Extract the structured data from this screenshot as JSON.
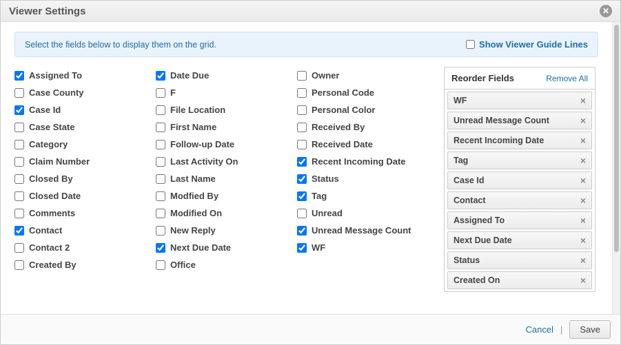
{
  "header": {
    "title": "Viewer Settings"
  },
  "info": {
    "text": "Select the fields below to display them on the grid.",
    "guide_label": "Show Viewer Guide Lines",
    "guide_checked": false
  },
  "fields": {
    "col1": [
      {
        "label": "Assigned To",
        "checked": true
      },
      {
        "label": "Case County",
        "checked": false
      },
      {
        "label": "Case Id",
        "checked": true
      },
      {
        "label": "Case State",
        "checked": false
      },
      {
        "label": "Category",
        "checked": false
      },
      {
        "label": "Claim Number",
        "checked": false
      },
      {
        "label": "Closed By",
        "checked": false
      },
      {
        "label": "Closed Date",
        "checked": false
      },
      {
        "label": "Comments",
        "checked": false
      },
      {
        "label": "Contact",
        "checked": true
      },
      {
        "label": "Contact 2",
        "checked": false
      },
      {
        "label": "Created By",
        "checked": false
      }
    ],
    "col2": [
      {
        "label": "Date Due",
        "checked": true
      },
      {
        "label": "F",
        "checked": false
      },
      {
        "label": "File Location",
        "checked": false
      },
      {
        "label": "First Name",
        "checked": false
      },
      {
        "label": "Follow-up Date",
        "checked": false
      },
      {
        "label": "Last Activity On",
        "checked": false
      },
      {
        "label": "Last Name",
        "checked": false
      },
      {
        "label": "Modfied By",
        "checked": false
      },
      {
        "label": "Modified On",
        "checked": false
      },
      {
        "label": "New Reply",
        "checked": false
      },
      {
        "label": "Next Due Date",
        "checked": true
      },
      {
        "label": "Office",
        "checked": false
      }
    ],
    "col3": [
      {
        "label": "Owner",
        "checked": false
      },
      {
        "label": "Personal Code",
        "checked": false
      },
      {
        "label": "Personal Color",
        "checked": false
      },
      {
        "label": "Received By",
        "checked": false
      },
      {
        "label": "Received Date",
        "checked": false
      },
      {
        "label": "Recent Incoming Date",
        "checked": true
      },
      {
        "label": "Status",
        "checked": true
      },
      {
        "label": "Tag",
        "checked": true
      },
      {
        "label": "Unread",
        "checked": false
      },
      {
        "label": "Unread Message Count",
        "checked": true
      },
      {
        "label": "WF",
        "checked": true
      }
    ]
  },
  "reorder": {
    "title": "Reorder Fields",
    "remove_all": "Remove All",
    "items": [
      "WF",
      "Unread Message Count",
      "Recent Incoming Date",
      "Tag",
      "Case Id",
      "Contact",
      "Assigned To",
      "Next Due Date",
      "Status",
      "Created On"
    ]
  },
  "footer": {
    "cancel": "Cancel",
    "save": "Save"
  }
}
